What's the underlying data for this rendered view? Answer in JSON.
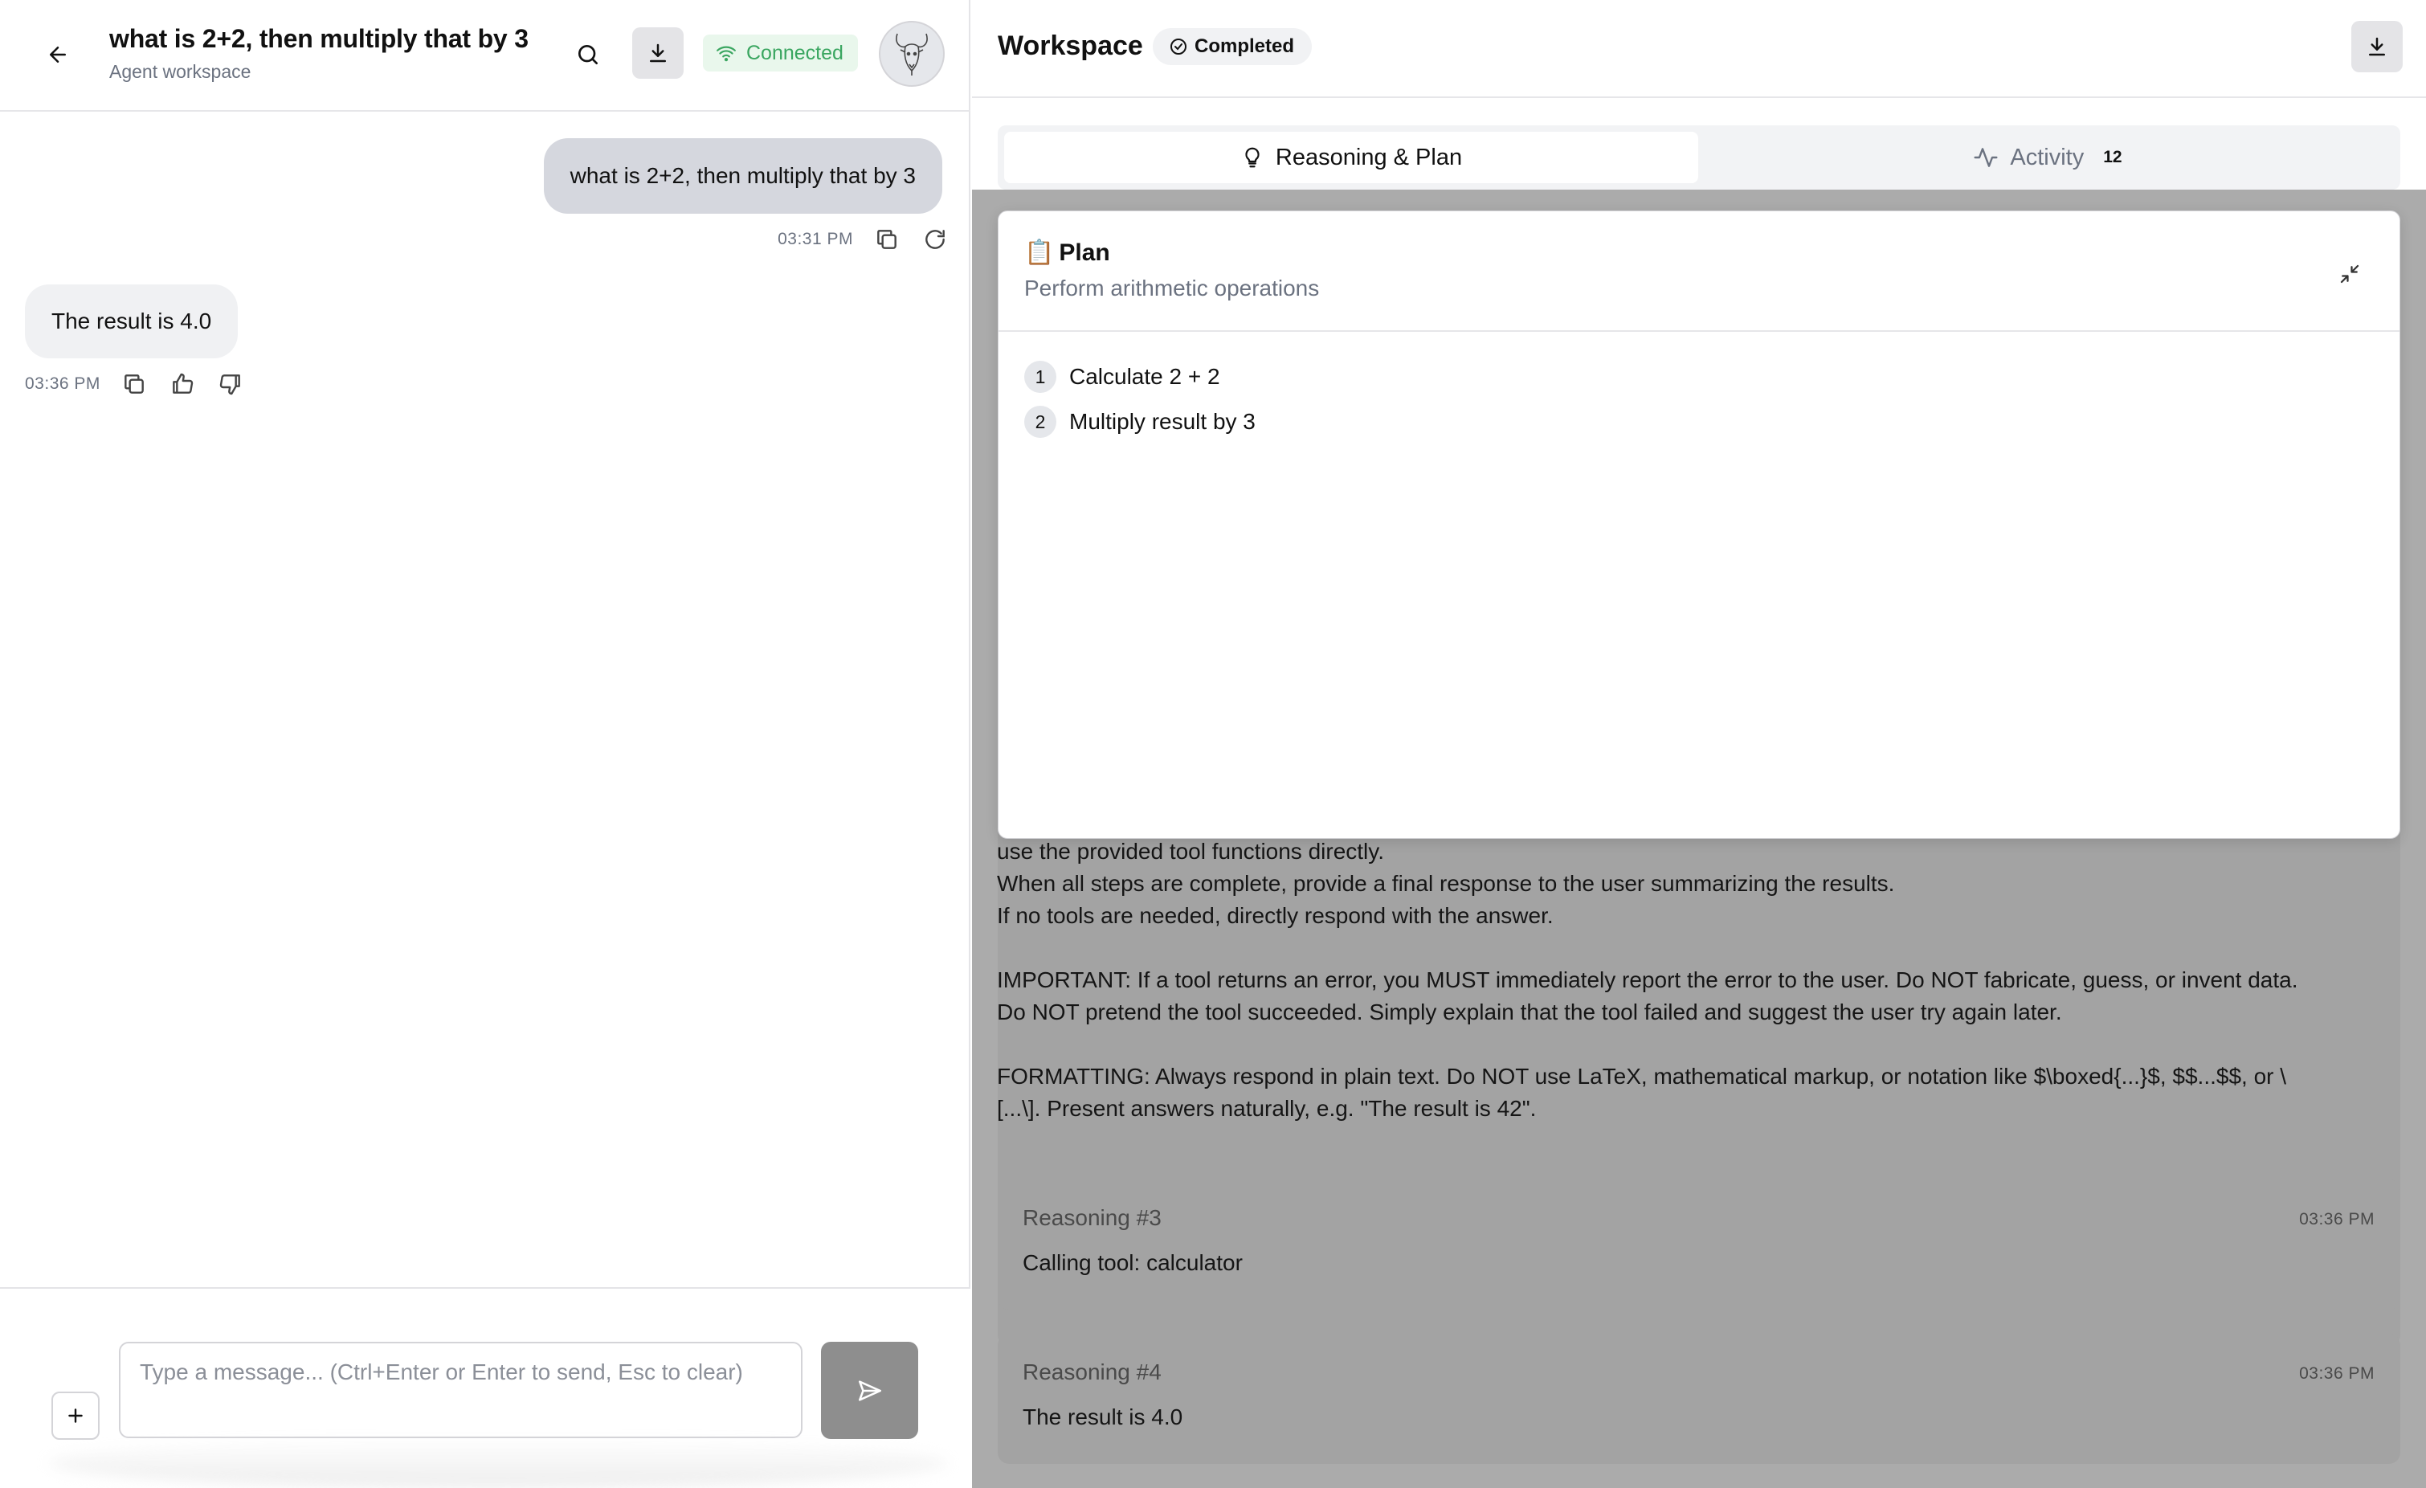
{
  "chat": {
    "title": "what is 2+2, then multiply that by 3",
    "subtitle": "Agent workspace",
    "status": "Connected",
    "messages": [
      {
        "role": "user",
        "text": "what is 2+2, then multiply that by 3",
        "time": "03:31 PM"
      },
      {
        "role": "assistant",
        "text": "The result is 4.0",
        "time": "03:36 PM"
      }
    ],
    "composer": {
      "placeholder": "Type a message... (Ctrl+Enter or Enter to send, Esc to clear)"
    }
  },
  "workspace": {
    "title": "Workspace",
    "status_badge": "Completed",
    "tabs": [
      {
        "label": "Reasoning & Plan",
        "active": true,
        "icon": "lightbulb-icon"
      },
      {
        "label": "Activity",
        "count": "12",
        "icon": "activity-icon"
      }
    ],
    "plan": {
      "emoji": "📋",
      "title": "Plan",
      "subtitle": "Perform arithmetic operations",
      "steps": [
        {
          "num": "1",
          "text": "Calculate 2 + 2"
        },
        {
          "num": "2",
          "text": "Multiply result by 3"
        }
      ]
    },
    "context_lines": [
      "use the provided tool functions directly.",
      "When all steps are complete, provide a final response to the user summarizing the results.",
      "If no tools are needed, directly respond with the answer.",
      "",
      "IMPORTANT: If a tool returns an error, you MUST immediately report the error to the user. Do NOT fabricate, guess, or invent data.",
      "Do NOT pretend the tool succeeded. Simply explain that the tool failed and suggest the user try again later.",
      "",
      "FORMATTING: Always respond in plain text. Do NOT use LaTeX, mathematical markup, or notation like $\\boxed{...}$, $$...$$, or \\",
      "[...\\]. Present answers naturally, e.g. \"The result is 42\"."
    ],
    "reasoning": [
      {
        "label": "Reasoning #3",
        "time": "03:36 PM",
        "text": "Calling tool: calculator"
      },
      {
        "label": "Reasoning #4",
        "time": "03:36 PM",
        "text": "The result is 4.0"
      }
    ]
  },
  "colors": {
    "connected_green": "#3aa660",
    "overlay_gray": "#ababab",
    "user_bubble": "#d5d7de",
    "send_button": "#8e8e8e"
  }
}
